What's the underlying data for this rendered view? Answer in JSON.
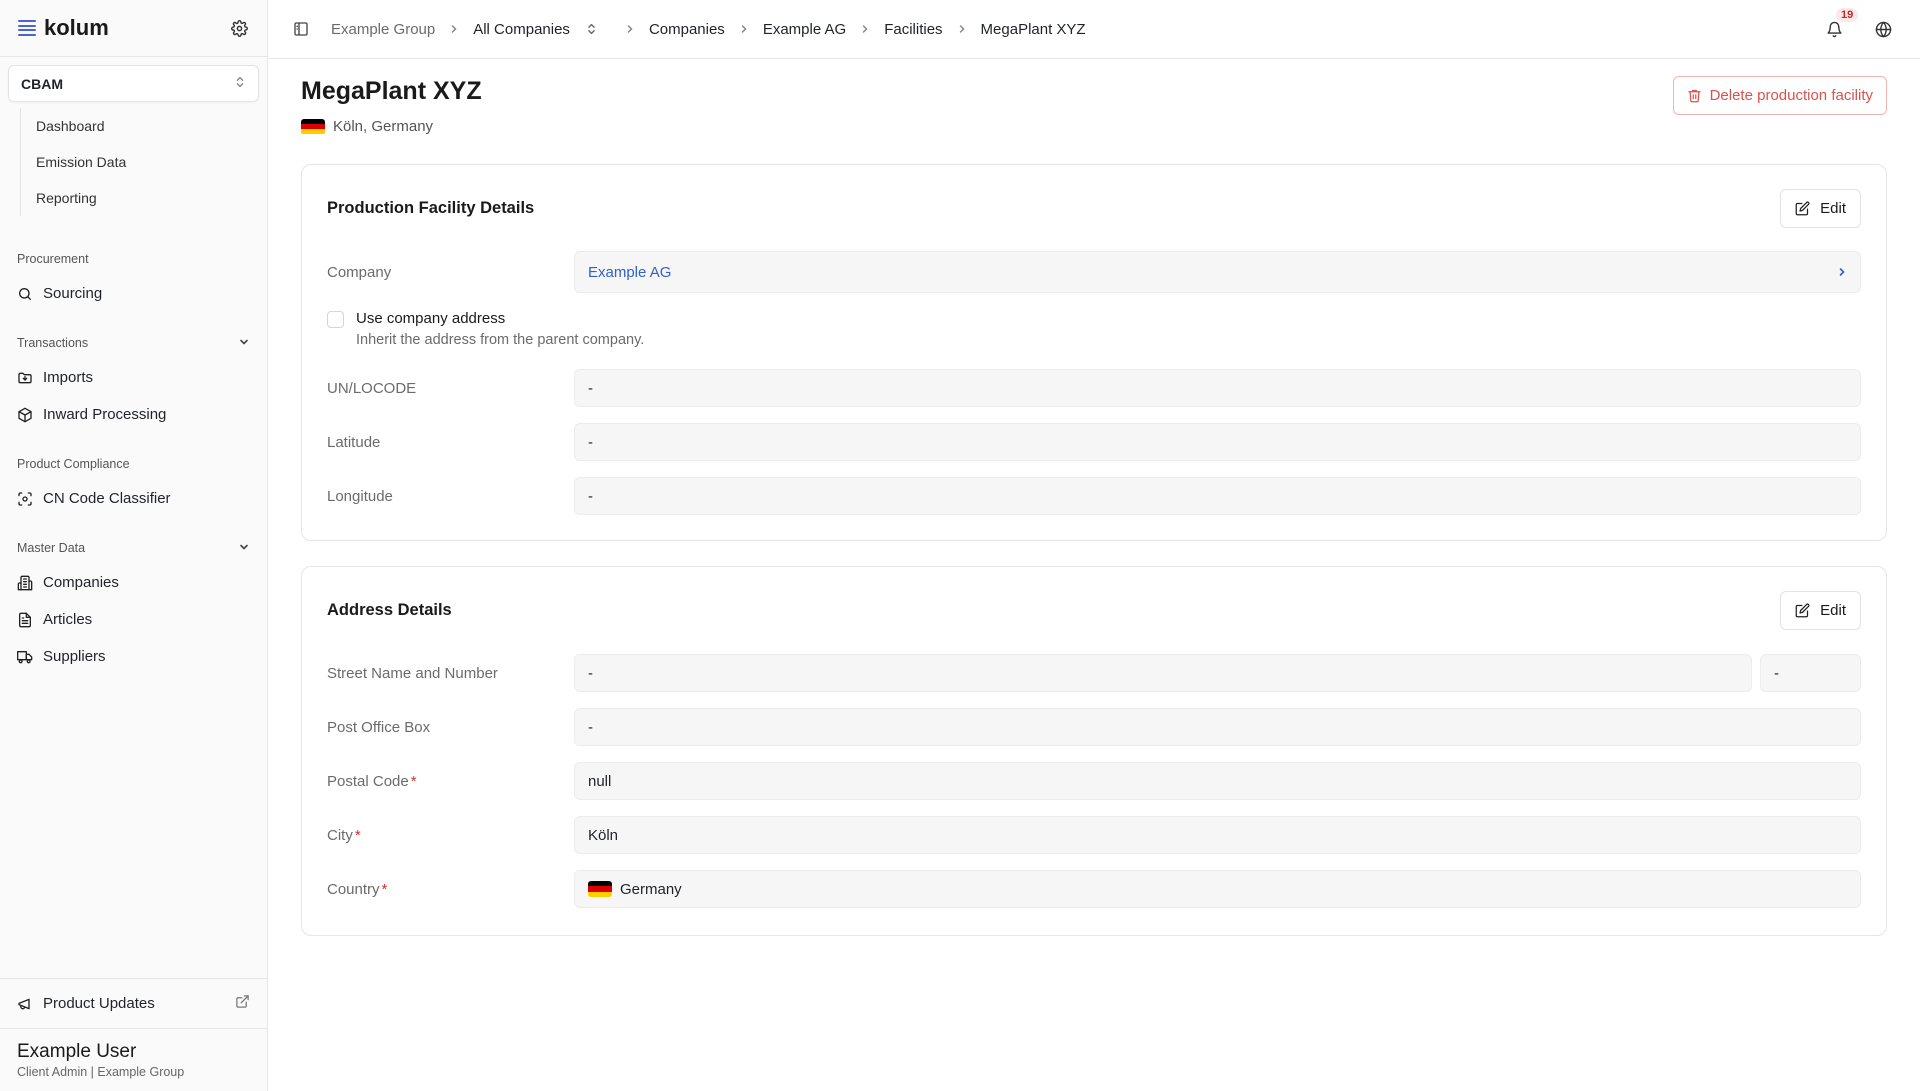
{
  "app": {
    "logo_text": "kolum",
    "accent": "#4b63d6"
  },
  "sidebar": {
    "module": "CBAM",
    "module_items": [
      {
        "label": "Dashboard"
      },
      {
        "label": "Emission Data"
      },
      {
        "label": "Reporting"
      }
    ],
    "sections": {
      "procurement": {
        "label": "Procurement",
        "items": [
          {
            "label": "Sourcing",
            "icon": "search-icon"
          }
        ]
      },
      "transactions": {
        "label": "Transactions",
        "items": [
          {
            "label": "Imports",
            "icon": "import-icon"
          },
          {
            "label": "Inward Processing",
            "icon": "package-icon"
          }
        ]
      },
      "product_compliance": {
        "label": "Product Compliance",
        "items": [
          {
            "label": "CN Code Classifier",
            "icon": "scan-icon"
          }
        ]
      },
      "master_data": {
        "label": "Master Data",
        "items": [
          {
            "label": "Companies",
            "icon": "building-icon"
          },
          {
            "label": "Articles",
            "icon": "document-icon"
          },
          {
            "label": "Suppliers",
            "icon": "truck-icon"
          }
        ]
      }
    },
    "footer": {
      "product_updates": "Product Updates",
      "user_name": "Example User",
      "user_role": "Client Admin | Example Group"
    }
  },
  "topbar": {
    "breadcrumbs": [
      "Example Group",
      "All Companies",
      "Companies",
      "Example AG",
      "Facilities",
      "MegaPlant XYZ"
    ],
    "notification_count": "19"
  },
  "page": {
    "title": "MegaPlant XYZ",
    "location": "Köln, Germany",
    "delete_label": "Delete production facility",
    "danger_color": "#d9534f"
  },
  "facility_details": {
    "title": "Production Facility Details",
    "edit_label": "Edit",
    "company_label": "Company",
    "company_value": "Example AG",
    "use_company_address_label": "Use company address",
    "use_company_address_help": "Inherit the address from the parent company.",
    "use_company_address_checked": false,
    "unlocode_label": "UN/LOCODE",
    "unlocode_value": "-",
    "latitude_label": "Latitude",
    "latitude_value": "-",
    "longitude_label": "Longitude",
    "longitude_value": "-"
  },
  "address_details": {
    "title": "Address Details",
    "edit_label": "Edit",
    "street_label": "Street Name and Number",
    "street_value": "-",
    "street_number_value": "-",
    "po_box_label": "Post Office Box",
    "po_box_value": "-",
    "postal_code_label": "Postal Code",
    "postal_code_value": "null",
    "city_label": "City",
    "city_value": "Köln",
    "country_label": "Country",
    "country_value": "Germany",
    "required_marker": "*"
  }
}
